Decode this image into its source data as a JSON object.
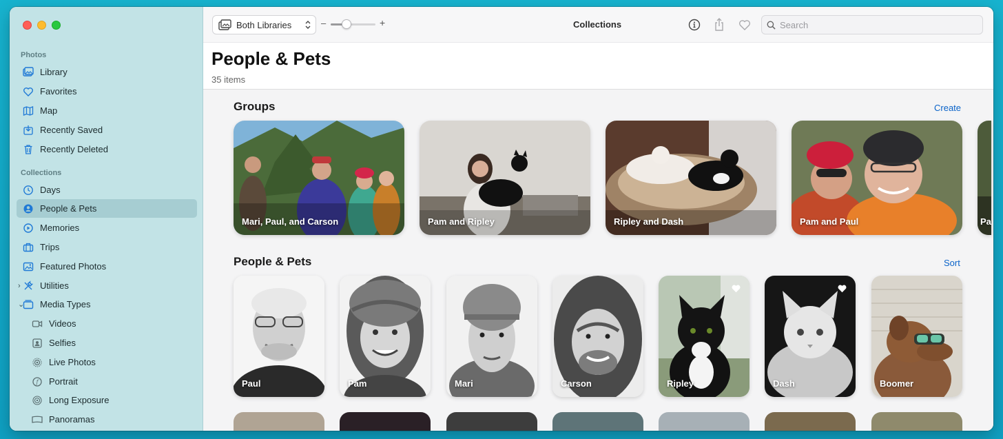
{
  "sidebar": {
    "photos_header": "Photos",
    "collections_header": "Collections",
    "items": [
      {
        "label": "Library",
        "icon": "library-icon"
      },
      {
        "label": "Favorites",
        "icon": "heart-icon"
      },
      {
        "label": "Map",
        "icon": "map-icon"
      },
      {
        "label": "Recently Saved",
        "icon": "recently-saved-icon"
      },
      {
        "label": "Recently Deleted",
        "icon": "trash-icon"
      },
      {
        "label": "Days",
        "icon": "clock-icon"
      },
      {
        "label": "People & Pets",
        "icon": "person-circle-icon",
        "selected": true
      },
      {
        "label": "Memories",
        "icon": "memories-icon"
      },
      {
        "label": "Trips",
        "icon": "suitcase-icon"
      },
      {
        "label": "Featured Photos",
        "icon": "photo-icon"
      },
      {
        "label": "Utilities",
        "icon": "utilities-icon"
      },
      {
        "label": "Media Types",
        "icon": "media-types-icon"
      },
      {
        "label": "Videos",
        "icon": "video-icon"
      },
      {
        "label": "Selfies",
        "icon": "selfie-icon"
      },
      {
        "label": "Live Photos",
        "icon": "live-photo-icon"
      },
      {
        "label": "Portrait",
        "icon": "portrait-icon"
      },
      {
        "label": "Long Exposure",
        "icon": "long-exposure-icon"
      },
      {
        "label": "Panoramas",
        "icon": "panorama-icon"
      }
    ]
  },
  "toolbar": {
    "library_select": "Both Libraries",
    "zoom_minus": "–",
    "zoom_plus": "+",
    "zoom_level": 0.35,
    "title": "Collections",
    "search_placeholder": "Search"
  },
  "main": {
    "title": "People & Pets",
    "count": "35 items",
    "groups_title": "Groups",
    "groups_action": "Create",
    "groups": [
      {
        "label": "Mari, Paul, and Carson"
      },
      {
        "label": "Pam and Ripley"
      },
      {
        "label": "Ripley and Dash"
      },
      {
        "label": "Pam and Paul"
      },
      {
        "label": "Pa"
      }
    ],
    "people_title": "People & Pets",
    "people_action": "Sort",
    "people": [
      {
        "label": "Paul",
        "favorite": false
      },
      {
        "label": "Pam",
        "favorite": false
      },
      {
        "label": "Mari",
        "favorite": false
      },
      {
        "label": "Carson",
        "favorite": false
      },
      {
        "label": "Ripley",
        "favorite": true
      },
      {
        "label": "Dash",
        "favorite": true
      },
      {
        "label": "Boomer",
        "favorite": false
      }
    ]
  },
  "colors": {
    "sidebar_bg": "#c2e3e6",
    "sidebar_selected": "#a6cdd2",
    "accent_icon": "#1f79d6",
    "link": "#0a63c9",
    "desktop": "#17b3cf"
  }
}
